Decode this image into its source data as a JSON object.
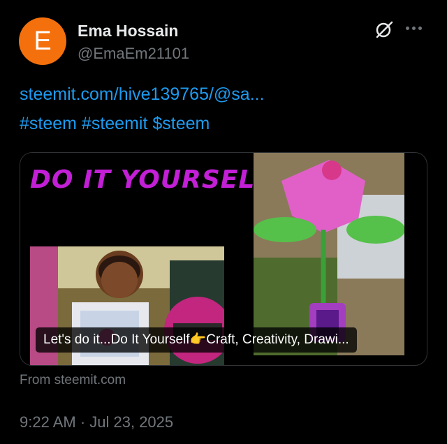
{
  "author": {
    "avatar_letter": "E",
    "avatar_color": "#f4700c",
    "name": "Ema Hossain",
    "handle": "@EmaEm21101"
  },
  "header_icons": [
    "grok-icon",
    "more-options-icon"
  ],
  "tweet": {
    "link": "steemit.com/hive139765/@sa...",
    "hashtags": "#steem #steemit $steem"
  },
  "card": {
    "image_title": "DO IT YOURSELF",
    "caption": "Let's do it...Do It Yourself👉Craft, Creativity, Drawi...",
    "source": "From steemit.com"
  },
  "timestamp": "9:22 AM · Jul 23, 2025",
  "colors": {
    "link": "#1d9bf0",
    "muted": "#71767b",
    "diy_title": "#c21fd6"
  }
}
